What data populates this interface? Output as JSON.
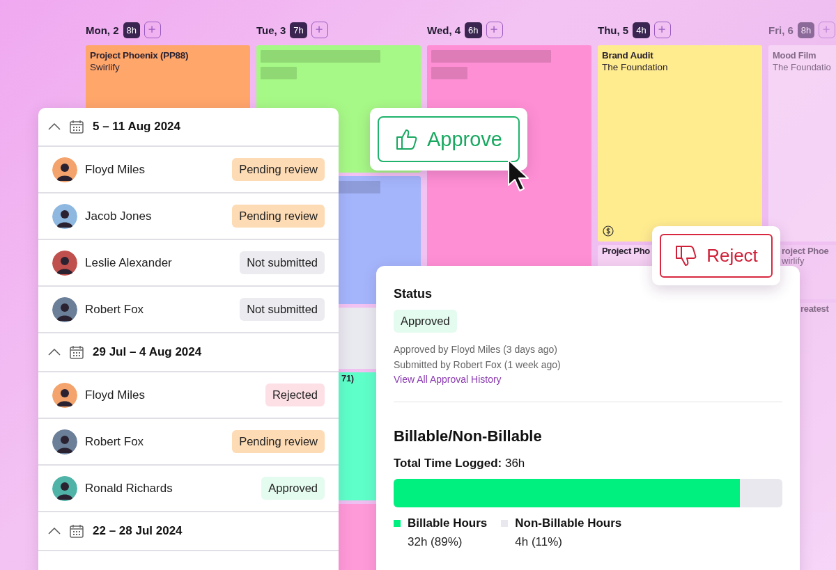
{
  "days": [
    {
      "label": "Mon, 2",
      "hours": "8h",
      "faded": false,
      "blocks": [
        {
          "kind": "event",
          "title": "Project Phoenix (PP88)",
          "subtitle": "Swirlify",
          "color": "#ffa66b",
          "billable": false
        }
      ]
    },
    {
      "label": "Tue, 3",
      "hours": "7h",
      "faded": false,
      "blocks": [
        {
          "kind": "placeholder",
          "color": "#a6f986"
        },
        {
          "kind": "placeholder",
          "color": "#a4b5fb"
        },
        {
          "kind": "blank",
          "color": "#e9e9f0"
        },
        {
          "kind": "event",
          "title": "71)",
          "color": "#5effc9",
          "billable": false
        },
        {
          "kind": "blank",
          "color": "#ff9ad8"
        }
      ]
    },
    {
      "label": "Wed, 4",
      "hours": "6h",
      "faded": false,
      "blocks": [
        {
          "kind": "placeholder",
          "color": "#ff8fd4"
        }
      ]
    },
    {
      "label": "Thu, 5",
      "hours": "4h",
      "faded": false,
      "blocks": [
        {
          "kind": "event",
          "title": "Brand Audit",
          "subtitle": "The Foundation",
          "color": "#ffec8f",
          "billable": true
        },
        {
          "kind": "event",
          "title": "Project Pho",
          "color": "#f6d2f4",
          "billable": false
        }
      ]
    },
    {
      "label": "Fri, 6",
      "hours": "8h",
      "faded": true,
      "blocks": [
        {
          "kind": "event",
          "title": "Mood Film",
          "subtitle": "The Foundatio",
          "color": "#fbe6fb",
          "billable": false
        },
        {
          "kind": "event",
          "title": "roject Phoe",
          "subtitle": "wirlify",
          "color": "#f6d2f4",
          "billable": false
        },
        {
          "kind": "event",
          "title": "reatest",
          "color": "#f6d2f4",
          "billable": false
        }
      ]
    }
  ],
  "timesheets": [
    {
      "range": "5 – 11 Aug 2024",
      "expanded": true,
      "rows": [
        {
          "name": "Floyd Miles",
          "status": "Pending review",
          "kind": "pending"
        },
        {
          "name": "Jacob Jones",
          "status": "Pending review",
          "kind": "pending"
        },
        {
          "name": "Leslie Alexander",
          "status": "Not submitted",
          "kind": "not_submitted"
        },
        {
          "name": "Robert Fox",
          "status": "Not submitted",
          "kind": "not_submitted"
        }
      ]
    },
    {
      "range": "29 Jul – 4 Aug 2024",
      "expanded": true,
      "rows": [
        {
          "name": "Floyd Miles",
          "status": "Rejected",
          "kind": "rejected"
        },
        {
          "name": "Robert Fox",
          "status": "Pending review",
          "kind": "pending"
        },
        {
          "name": "Ronald Richards",
          "status": "Approved",
          "kind": "approved"
        }
      ]
    },
    {
      "range": "22 – 28 Jul 2024",
      "expanded": true
    }
  ],
  "approve_button": {
    "label": "Approve"
  },
  "reject_button": {
    "label": "Reject"
  },
  "status_card": {
    "heading": "Status",
    "status": {
      "label": "Approved",
      "kind": "approved"
    },
    "approved_by": "Approved by Floyd Miles (3 days ago)",
    "submitted_by": "Submitted by Robert Fox (1 week ago)",
    "history_link": "View All Approval History",
    "billing_heading": "Billable/Non-Billable",
    "total": "**Total Time Logged:** 36h",
    "level": 0.89,
    "legend": [
      {
        "label": "Billable Hours",
        "value": "32h (89%)",
        "color": "#00f07f"
      },
      {
        "label": "Non-Billable Hours",
        "value": "4h (11%)",
        "color": "#e8e8ee"
      }
    ]
  }
}
